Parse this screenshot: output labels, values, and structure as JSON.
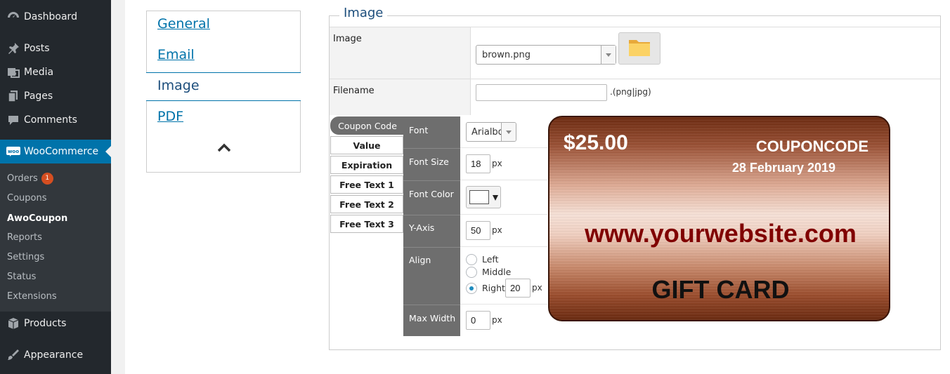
{
  "sidebar": {
    "items": [
      {
        "label": "Dashboard",
        "icon": "dashboard-icon"
      },
      {
        "label": "Posts",
        "icon": "pin-icon"
      },
      {
        "label": "Media",
        "icon": "media-icon"
      },
      {
        "label": "Pages",
        "icon": "pages-icon"
      },
      {
        "label": "Comments",
        "icon": "comment-icon"
      },
      {
        "label": "WooCommerce",
        "icon": "woo-icon"
      },
      {
        "label": "Products",
        "icon": "box-icon"
      },
      {
        "label": "Appearance",
        "icon": "brush-icon"
      }
    ],
    "submenu": [
      {
        "label": "Orders",
        "badge": "1"
      },
      {
        "label": "Coupons"
      },
      {
        "label": "AwoCoupon"
      },
      {
        "label": "Reports"
      },
      {
        "label": "Settings"
      },
      {
        "label": "Status"
      },
      {
        "label": "Extensions"
      }
    ],
    "accent": "#0073aa"
  },
  "tabs": {
    "items": [
      {
        "label": "General"
      },
      {
        "label": "Email"
      },
      {
        "label": "Image"
      },
      {
        "label": "PDF"
      }
    ],
    "active": "Image",
    "collapse_icon": "chevron-up-icon"
  },
  "image_section": {
    "legend": "Image",
    "image_label": "Image",
    "image_select_value": "brown.png",
    "folder_icon": "folder-icon",
    "filename_label": "Filename",
    "filename_value": "",
    "filename_suffix": ".(png|jpg)"
  },
  "field_buttons": [
    {
      "label": "Coupon Code"
    },
    {
      "label": "Value"
    },
    {
      "label": "Expiration"
    },
    {
      "label": "Free Text 1"
    },
    {
      "label": "Free Text 2"
    },
    {
      "label": "Free Text 3"
    }
  ],
  "properties": {
    "font": {
      "label": "Font",
      "value": "Arialbd"
    },
    "font_size": {
      "label": "Font Size",
      "value": "18",
      "unit": "px"
    },
    "font_color": {
      "label": "Font Color",
      "value": "#ffffff"
    },
    "y_axis": {
      "label": "Y-Axis",
      "value": "50",
      "unit": "px"
    },
    "align": {
      "label": "Align",
      "options": [
        "Left",
        "Middle",
        "Right"
      ],
      "selected": "Right",
      "padding": "20",
      "unit": "px"
    },
    "max_width": {
      "label": "Max Width",
      "value": "0",
      "unit": "px"
    }
  },
  "card": {
    "value": "$25.00",
    "coupon_code": "COUPONCODE",
    "expiration": "28 February 2019",
    "website": "www.yourwebsite.com",
    "title": "GIFT CARD"
  }
}
